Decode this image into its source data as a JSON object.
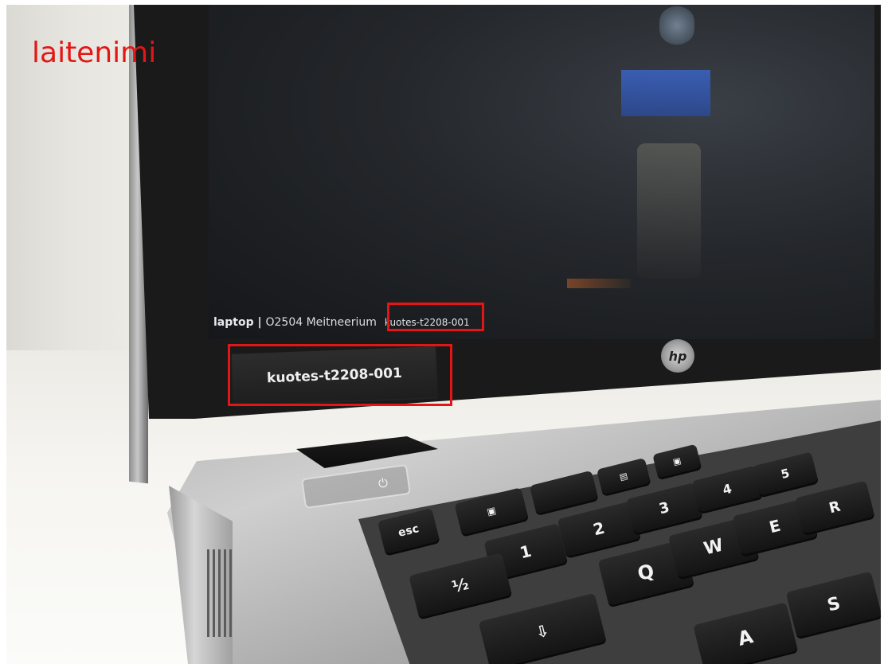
{
  "annotation": {
    "label": "laitenimi",
    "color": "#e31616"
  },
  "screen_caption": {
    "device_type": "laptop",
    "separator": "|",
    "room": "O2504 Meitneerium",
    "device_name": "kuotes-t2208-001"
  },
  "sticker": {
    "text": "kuotes-t2208-001"
  },
  "brand_logo": {
    "text": "hp"
  },
  "keyboard": {
    "keys": [
      {
        "id": "key-esc",
        "label": "esc"
      },
      {
        "id": "key-f1",
        "label": ""
      },
      {
        "id": "key-f2",
        "label": ""
      },
      {
        "id": "key-f3",
        "label": ""
      },
      {
        "id": "key-f4",
        "label": ""
      },
      {
        "id": "key-1",
        "label": "1"
      },
      {
        "id": "key-2",
        "label": "2"
      },
      {
        "id": "key-3",
        "label": "3"
      },
      {
        "id": "key-4",
        "label": "4"
      },
      {
        "id": "key-5",
        "label": "5"
      },
      {
        "id": "key-tab",
        "label": "½"
      },
      {
        "id": "key-q",
        "label": "Q"
      },
      {
        "id": "key-w",
        "label": "W"
      },
      {
        "id": "key-e",
        "label": "E"
      },
      {
        "id": "key-r",
        "label": "R"
      },
      {
        "id": "key-caps",
        "label": ""
      },
      {
        "id": "key-a",
        "label": "A"
      },
      {
        "id": "key-s",
        "label": "S"
      }
    ]
  }
}
